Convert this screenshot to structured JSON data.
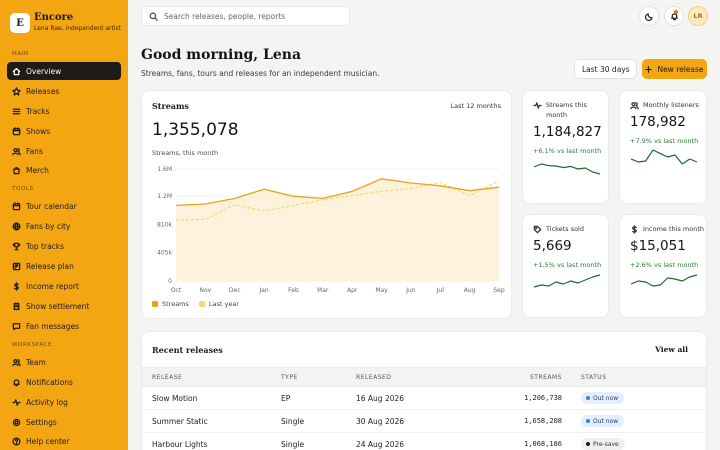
{
  "brand": {
    "initial": "E",
    "name": "Encore",
    "subtitle": "Lena Rae, independent artist"
  },
  "sidebar": {
    "sections": {
      "main": "MAIN",
      "tools": "TOOLS",
      "workspace": "WORKSPACE"
    },
    "main_items": [
      {
        "label": "Overview",
        "icon": "home-icon",
        "active": true
      },
      {
        "label": "Releases",
        "icon": "star-icon"
      },
      {
        "label": "Tracks",
        "icon": "list-icon"
      },
      {
        "label": "Shows",
        "icon": "calendar-icon"
      },
      {
        "label": "Fans",
        "icon": "users-icon"
      },
      {
        "label": "Merch",
        "icon": "bag-icon"
      }
    ],
    "tool_items": [
      {
        "label": "Tour calendar",
        "icon": "calendar-icon"
      },
      {
        "label": "Fans by city",
        "icon": "globe-icon"
      },
      {
        "label": "Top tracks",
        "icon": "trophy-icon"
      },
      {
        "label": "Release plan",
        "icon": "kanban-icon"
      },
      {
        "label": "Income report",
        "icon": "dollar-icon"
      },
      {
        "label": "Show settlement",
        "icon": "receipt-icon"
      },
      {
        "label": "Fan messages",
        "icon": "message-icon"
      }
    ],
    "workspace_items": [
      {
        "label": "Team",
        "icon": "team-icon"
      },
      {
        "label": "Notifications",
        "icon": "bell-icon"
      },
      {
        "label": "Activity log",
        "icon": "activity-icon"
      },
      {
        "label": "Settings",
        "icon": "gear-icon"
      },
      {
        "label": "Help center",
        "icon": "help-icon"
      }
    ]
  },
  "topbar": {
    "search_placeholder": "Search releases, people, reports",
    "avatar_initials": "LR"
  },
  "header": {
    "greeting": "Good morning, Lena",
    "subtitle": "Streams, fans, tours and releases for an independent musician.",
    "range_label": "Last 30 days",
    "new_release_label": "New release"
  },
  "streams": {
    "title": "Streams",
    "range": "Last 12 months",
    "value": "1,355,078",
    "caption": "Streams, this month"
  },
  "chart_data": {
    "type": "line",
    "categories": [
      "Oct",
      "Nov",
      "Dec",
      "Jan",
      "Feb",
      "Mar",
      "Apr",
      "May",
      "Jun",
      "Jul",
      "Aug",
      "Sep"
    ],
    "series": [
      {
        "name": "Streams",
        "values": [
          1080000,
          1100000,
          1180000,
          1310000,
          1210000,
          1180000,
          1280000,
          1460000,
          1400000,
          1360000,
          1290000,
          1340000
        ]
      },
      {
        "name": "Last year",
        "values": [
          870000,
          880000,
          1090000,
          1000000,
          1080000,
          1160000,
          1220000,
          1280000,
          1320000,
          1410000,
          1220000,
          1430000
        ]
      }
    ],
    "ylim": [
      0,
      1600000
    ],
    "yticks": [
      "0",
      "405k",
      "810k",
      "1.2M",
      "1.6M"
    ],
    "ytick_values": [
      0,
      405000,
      810000,
      1215000,
      1600000
    ],
    "colors": {
      "streams": "#e8a317",
      "last_year": "#f5d76e"
    },
    "grid": true,
    "legend": "bottom-left"
  },
  "stats": [
    {
      "label": "Streams this month",
      "icon": "pulse-icon",
      "value": "1,184,827",
      "delta": "+6.1% vs last month",
      "spark": [
        0.55,
        0.7,
        0.62,
        0.6,
        0.52,
        0.58,
        0.45,
        0.5,
        0.3,
        0.2
      ]
    },
    {
      "label": "Monthly listeners",
      "icon": "users-icon",
      "value": "178,982",
      "delta": "+7.9% vs last month",
      "spark": [
        0.45,
        0.3,
        0.35,
        0.9,
        0.72,
        0.55,
        0.65,
        0.2,
        0.45,
        0.3
      ]
    },
    {
      "label": "Tickets sold",
      "icon": "tag-icon",
      "value": "5,669",
      "delta": "+1.5% vs last month",
      "spark": [
        0.25,
        0.35,
        0.3,
        0.5,
        0.4,
        0.55,
        0.45,
        0.6,
        0.75,
        0.85
      ]
    },
    {
      "label": "Income this month",
      "icon": "dollar-icon",
      "value": "$15,051",
      "delta": "+2.6% vs last month",
      "spark": [
        0.4,
        0.55,
        0.5,
        0.3,
        0.35,
        0.7,
        0.65,
        0.55,
        0.75,
        0.85
      ]
    }
  ],
  "releases": {
    "title": "Recent releases",
    "view_all": "View all",
    "columns": [
      "RELEASE",
      "TYPE",
      "RELEASED",
      "STREAMS",
      "STATUS"
    ],
    "rows": [
      {
        "release": "Slow Motion",
        "type": "EP",
        "released": "16 Aug 2026",
        "streams": "1,206,738",
        "status": "Out now"
      },
      {
        "release": "Summer Static",
        "type": "Single",
        "released": "30 Aug 2026",
        "streams": "1,658,208",
        "status": "Out now"
      },
      {
        "release": "Harbour Lights",
        "type": "Single",
        "released": "24 Aug 2026",
        "streams": "1,068,186",
        "status": "Pre-save"
      }
    ]
  },
  "colors": {
    "accent": "#f4a512",
    "sidebar_active": "#1f1c17",
    "positive": "#2e7d32",
    "spark": "#1b6b2e"
  }
}
